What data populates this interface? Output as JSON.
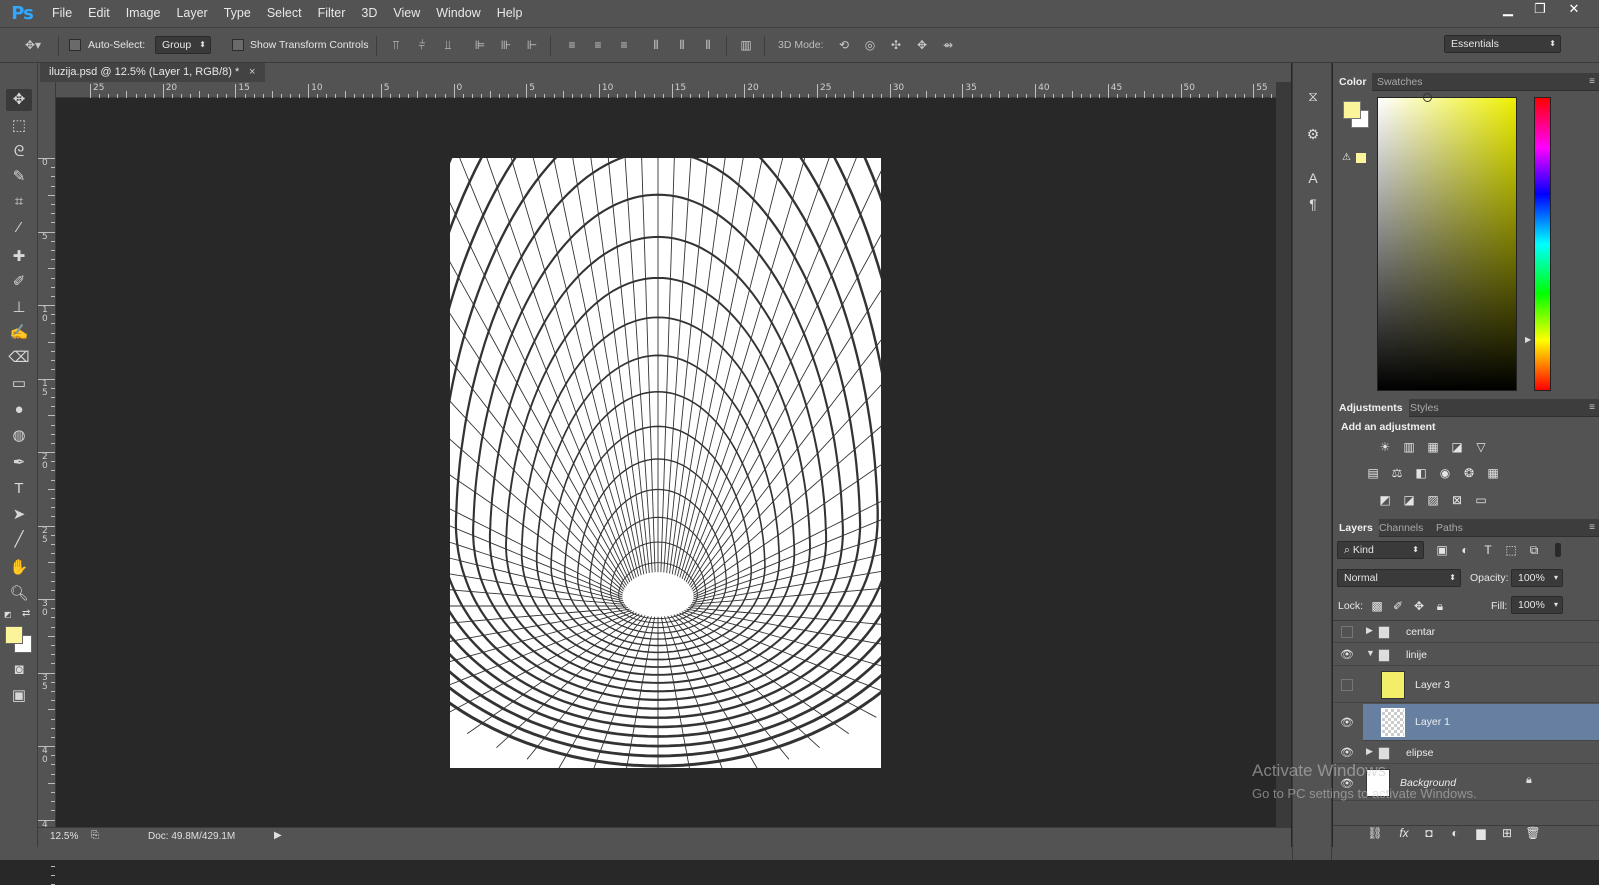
{
  "app": {
    "logo": "Ps",
    "menu": [
      "File",
      "Edit",
      "Image",
      "Layer",
      "Type",
      "Select",
      "Filter",
      "3D",
      "View",
      "Window",
      "Help"
    ],
    "window_controls": [
      "minimize",
      "restore",
      "close"
    ]
  },
  "options": {
    "auto_select": "Auto-Select:",
    "group_value": "Group",
    "show_transform": "Show Transform Controls",
    "mode_3d": "3D Mode:",
    "workspace": "Essentials"
  },
  "document": {
    "tab_title": "iluzija.psd @ 12.5% (Layer 1, RGB/8) *",
    "close": "×",
    "hruler": [
      "25",
      "20",
      "15",
      "10",
      "5",
      "0",
      "5",
      "10",
      "15",
      "20",
      "25",
      "30",
      "35",
      "40",
      "45",
      "50",
      "55"
    ],
    "vruler": [
      "0",
      "5",
      "1\n0",
      "1\n5",
      "2\n0",
      "2\n5",
      "3\n0",
      "3\n5",
      "4\n0",
      "4"
    ]
  },
  "status": {
    "zoom": "12.5%",
    "doc": "Doc: 49.8M/429.1M"
  },
  "panels": {
    "color_tabs": [
      "Color",
      "Swatches"
    ],
    "foreground": "#fcf49a",
    "background": "#ffffff",
    "adjust_tabs": [
      "Adjustments",
      "Styles"
    ],
    "adjust_title": "Add an adjustment",
    "layers_tabs": [
      "Layers",
      "Channels",
      "Paths"
    ],
    "kind": "Kind",
    "blend": "Normal",
    "opacity_label": "Opacity:",
    "opacity": "100%",
    "lock_label": "Lock:",
    "fill_label": "Fill:",
    "fill": "100%",
    "layers": [
      {
        "name": "centar",
        "type": "group",
        "visible": false,
        "open": false
      },
      {
        "name": "linije",
        "type": "group",
        "visible": true,
        "open": true
      },
      {
        "name": "Layer 3",
        "type": "layer",
        "visible": false
      },
      {
        "name": "Layer 1",
        "type": "layer",
        "visible": true,
        "selected": true
      },
      {
        "name": "elipse",
        "type": "group",
        "visible": true,
        "open": false
      },
      {
        "name": "Background",
        "type": "background",
        "visible": true
      }
    ]
  },
  "watermark": {
    "line1": "Activate Windows",
    "line2": "Go to PC settings to activate Windows."
  }
}
